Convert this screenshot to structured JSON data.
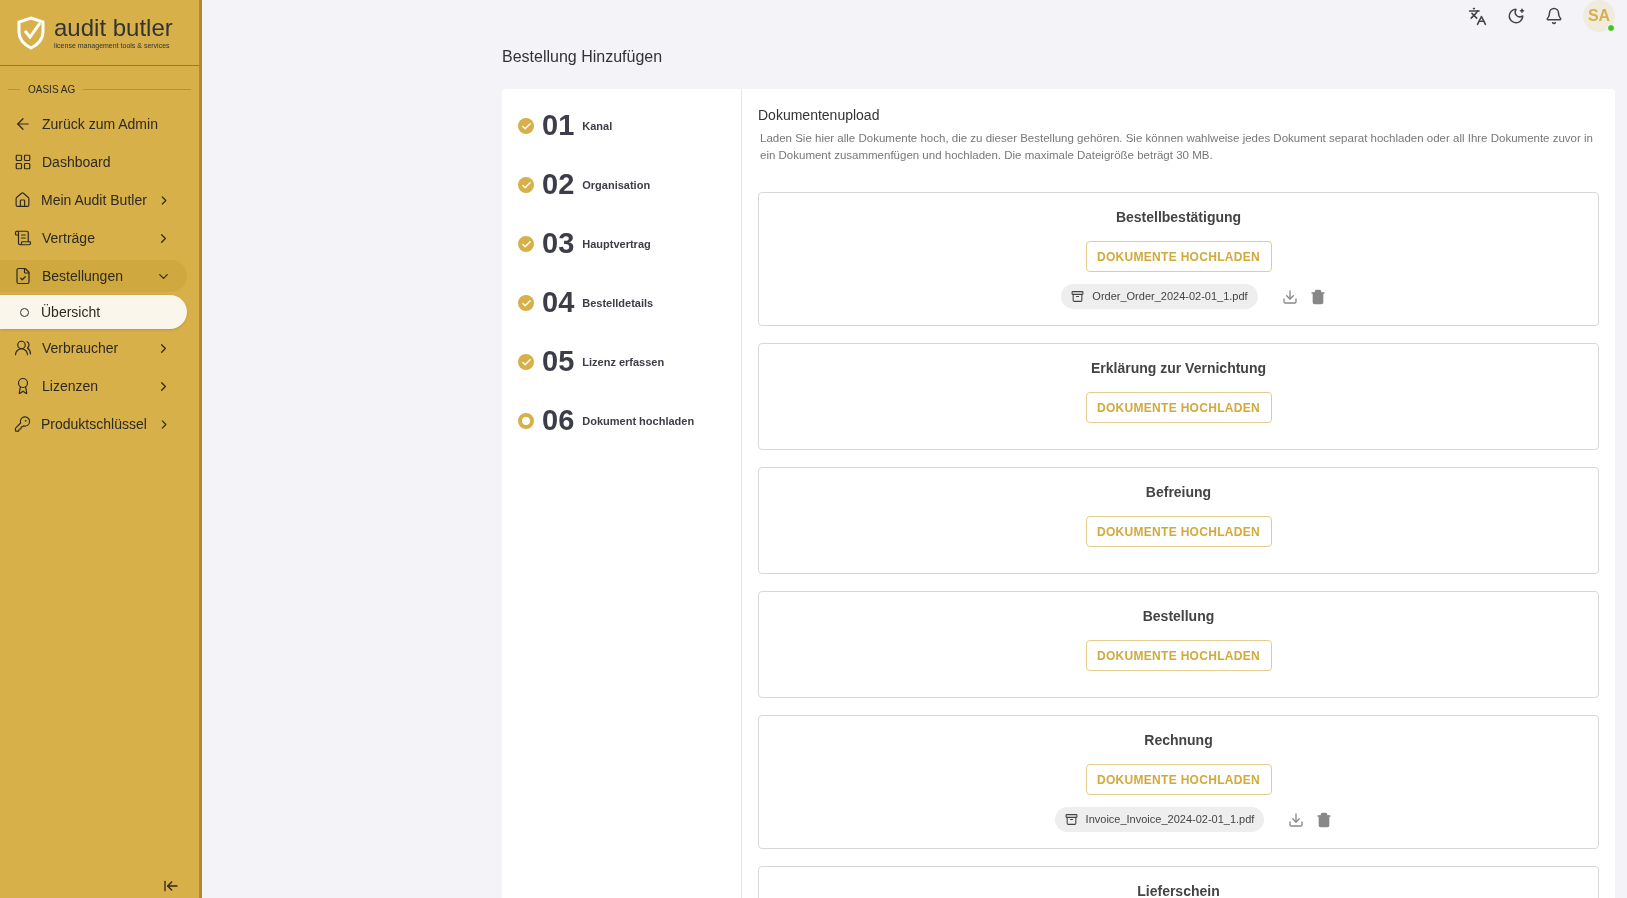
{
  "brand": {
    "name": "audit butler",
    "tagline": "license management tools & services"
  },
  "sidebar": {
    "organization": "OASIS AG",
    "items": [
      {
        "kind": "link",
        "label": "Zurück zum Admin",
        "selected": false
      },
      {
        "kind": "link",
        "label": "Dashboard",
        "selected": false
      },
      {
        "kind": "group",
        "label": "Mein Audit Butler",
        "selected": false,
        "expanded": false
      },
      {
        "kind": "group",
        "label": "Verträge",
        "selected": false,
        "expanded": false
      },
      {
        "kind": "group",
        "label": "Bestellungen",
        "selected": false,
        "expanded": true,
        "children": [
          {
            "kind": "sub",
            "label": "Übersicht",
            "selected": true
          }
        ]
      },
      {
        "kind": "group",
        "label": "Verbraucher",
        "selected": false,
        "expanded": false
      },
      {
        "kind": "group",
        "label": "Lizenzen",
        "selected": false,
        "expanded": false
      },
      {
        "kind": "group",
        "label": "Produktschlüssel",
        "selected": false,
        "expanded": false
      }
    ]
  },
  "header": {
    "avatar": "SA",
    "online": true
  },
  "page_title": "Bestellung Hinzufügen",
  "steps": [
    {
      "number": "01",
      "label": "Kanal",
      "done": true
    },
    {
      "number": "02",
      "label": "Organisation",
      "done": true
    },
    {
      "number": "03",
      "label": "Hauptvertrag",
      "done": true
    },
    {
      "number": "04",
      "label": "Bestelldetails",
      "done": true
    },
    {
      "number": "05",
      "label": "Lizenz erfassen",
      "done": true
    },
    {
      "number": "06",
      "label": "Dokument hochladen",
      "done": false
    }
  ],
  "upload": {
    "title": "Dokumentenupload",
    "description": "Laden Sie hier alle Dokumente hoch, die zu dieser Bestellung gehören. Sie können wahlweise jedes Dokument separat hochladen oder all Ihre Dokumente zuvor in ein Dokument zusammenfügen und hochladen. Die maximale Dateigröße beträgt 30 MB.",
    "sections": [
      {
        "title": "Bestellbestätigung",
        "button": "DOKUMENTE HOCHLADEN",
        "files": [
          "Order_Order_2024-02-01_1.pdf"
        ]
      },
      {
        "title": "Erklärung zur Vernichtung",
        "button": "DOKUMENTE HOCHLADEN"
      },
      {
        "title": "Befreiung",
        "button": "DOKUMENTE HOCHLADEN"
      },
      {
        "title": "Bestellung",
        "button": "DOKUMENTE HOCHLADEN"
      },
      {
        "title": "Rechnung",
        "button": "DOKUMENTE HOCHLADEN",
        "files": [
          "Invoice_Invoice_2024-02-01_1.pdf"
        ]
      },
      {
        "title": "Lieferschein"
      }
    ]
  }
}
